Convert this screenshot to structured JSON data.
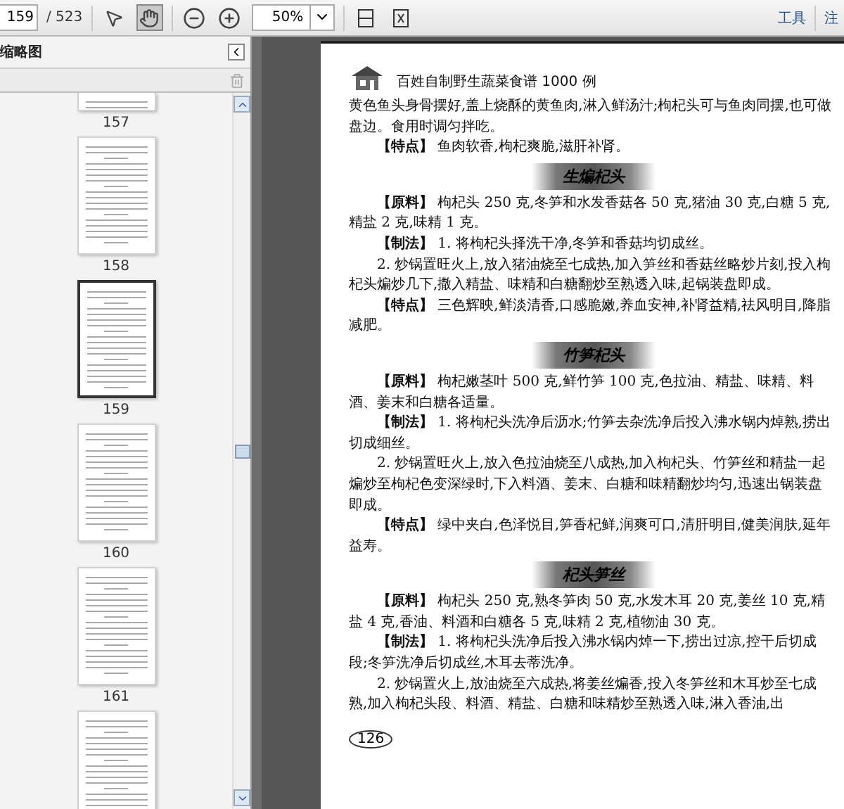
{
  "toolbar": {
    "page_number": "159",
    "page_total": "/ 523",
    "tools": [
      {
        "kind": "select",
        "selected": false
      },
      {
        "kind": "hand",
        "selected": true
      }
    ],
    "zoom": "50%",
    "links": [
      "工具",
      "注"
    ]
  },
  "sidebar": {
    "title": "缩略图",
    "thumbnails": [
      {
        "label": "157",
        "selected": false
      },
      {
        "label": "158",
        "selected": false
      },
      {
        "label": "159",
        "selected": true
      },
      {
        "label": "160",
        "selected": false
      },
      {
        "label": "161",
        "selected": false
      },
      {
        "selected": false
      }
    ]
  },
  "page": {
    "header": "百姓自制野生蔬菜食谱 1000 例",
    "blocks": [
      {
        "kind": "continuation",
        "text": "黄色鱼头身骨摆好,盖上烧酥的黄鱼肉,淋入鲜汤汁;枸杞头可与鱼肉同摆,也可做盘边。食用时调匀拌吃。"
      },
      {
        "kind": "para",
        "text": "**【特点】** 鱼肉软香,枸杞爽脆,滋肝补肾。"
      },
      {
        "kind": "heading",
        "text": "生煸杞头"
      },
      {
        "kind": "para",
        "text": "**【原料】** 枸杞头 250 克,冬笋和水发香菇各 50 克,猪油 30 克,白糖 5 克,精盐 2 克,味精 1 克。"
      },
      {
        "kind": "para",
        "text": "**【制法】** 1. 将枸杞头择洗干净,冬笋和香菇均切成丝。"
      },
      {
        "kind": "para",
        "text": "2. 炒锅置旺火上,放入猪油烧至七成热,加入笋丝和香菇丝略炒片刻,投入枸杞头煸炒几下,撒入精盐、味精和白糖翻炒至熟透入味,起锅装盘即成。"
      },
      {
        "kind": "para",
        "text": "**【特点】** 三色辉映,鲜淡清香,口感脆嫩,养血安神,补肾益精,祛风明目,降脂减肥。"
      },
      {
        "kind": "heading",
        "text": "竹笋杞头"
      },
      {
        "kind": "para",
        "text": "**【原料】** 枸杞嫩茎叶 500 克,鲜竹笋 100 克,色拉油、精盐、味精、料酒、姜末和白糖各适量。"
      },
      {
        "kind": "para",
        "text": "**【制法】** 1. 将枸杞头洗净后沥水;竹笋去杂洗净后投入沸水锅内焯熟,捞出切成细丝。"
      },
      {
        "kind": "para",
        "text": "2. 炒锅置旺火上,放入色拉油烧至八成热,加入枸杞头、竹笋丝和精盐一起煸炒至枸杞色变深绿时,下入料酒、姜末、白糖和味精翻炒均匀,迅速出锅装盘即成。"
      },
      {
        "kind": "para",
        "text": "**【特点】** 绿中夹白,色泽悦目,笋香杞鲜,润爽可口,清肝明目,健美润肤,延年益寿。"
      },
      {
        "kind": "heading",
        "text": "杞头笋丝"
      },
      {
        "kind": "para",
        "text": "**【原料】** 枸杞头 250 克,熟冬笋肉 50 克,水发木耳 20 克,姜丝 10 克,精盐 4 克,香油、料酒和白糖各 5 克,味精 2 克,植物油 30 克。"
      },
      {
        "kind": "para",
        "text": "**【制法】** 1. 将枸杞头洗净后投入沸水锅内焯一下,捞出过凉,控干后切成段;冬笋洗净后切成丝,木耳去蒂洗净。"
      },
      {
        "kind": "para",
        "text": "2. 炒锅置火上,放油烧至六成热,将姜丝煸香,投入冬笋丝和木耳炒至七成熟,加入枸杞头段、料酒、精盐、白糖和味精炒至熟透入味,淋入香油,出"
      }
    ],
    "page_number": "126"
  }
}
